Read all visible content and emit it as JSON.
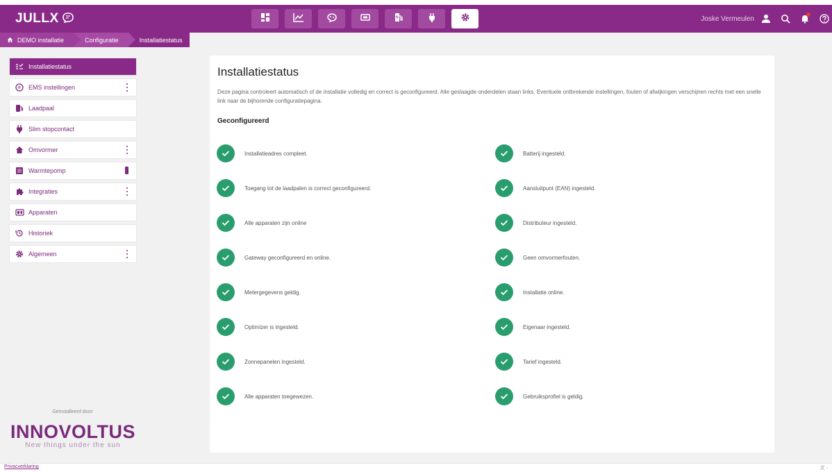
{
  "header": {
    "logo_text": "JULLX",
    "user_name": "Joske Vermeulen",
    "nav": [
      {
        "icon": "dashboard-icon",
        "active": false
      },
      {
        "icon": "chart-line-icon",
        "active": false
      },
      {
        "icon": "brain-icon",
        "active": false
      },
      {
        "icon": "battery-screen-icon",
        "active": false
      },
      {
        "icon": "charging-station-icon",
        "active": false
      },
      {
        "icon": "plug-icon",
        "active": false
      },
      {
        "icon": "gear-icon",
        "active": true
      }
    ]
  },
  "breadcrumbs": {
    "items": [
      "DEMO installatie",
      "Configuratie",
      "Installatiestatus"
    ]
  },
  "sidebar": {
    "items": [
      {
        "label": "Installatiestatus",
        "icon": "checklist-icon",
        "active": true,
        "menu": false
      },
      {
        "label": "EMS instellingen",
        "icon": "brain-icon",
        "active": false,
        "menu": true
      },
      {
        "label": "Laadpaal",
        "icon": "charging-station-icon",
        "active": false,
        "menu": false
      },
      {
        "label": "Slim stopcontact",
        "icon": "plug-icon",
        "active": false,
        "menu": false
      },
      {
        "label": "Omvormer",
        "icon": "house-icon",
        "active": false,
        "menu": true
      },
      {
        "label": "Warmtepomp",
        "icon": "heat-pump-icon",
        "active": false,
        "menu": false
      },
      {
        "label": "Integraties",
        "icon": "puzzle-icon",
        "active": false,
        "menu": true
      },
      {
        "label": "Apparaten",
        "icon": "devices-icon",
        "active": false,
        "menu": false
      },
      {
        "label": "Historiek",
        "icon": "history-icon",
        "active": false,
        "menu": false
      },
      {
        "label": "Algemeen",
        "icon": "gear-icon",
        "active": false,
        "menu": true
      }
    ],
    "installed_by_label": "Geïnstalleerd door:",
    "brand_name": "INNOVOLTUS",
    "brand_tagline": "New things under the sun"
  },
  "main": {
    "title": "Installatiestatus",
    "description": "Deze pagina controleert automatisch of de installatie volledig en correct is geconfigureerd. Alle geslaagde onderdelen staan links. Eventuele ontbrekende instellingen, fouten of afwijkingen verschijnen rechts met een snelle link naar de bijhorende configuratiepagina.",
    "section_title": "Geconfigureerd",
    "left_checks": [
      "Installatieadres compleet.",
      "Toegang tot de laadpalen is correct geconfigureerd.",
      "Alle apparaten zijn online",
      "Gateway geconfigureerd en online.",
      "Metergegevens geldig.",
      "Optimizer is ingesteld.",
      "Zonnepanelen ingesteld.",
      "Alle apparaten toegewezen."
    ],
    "right_checks": [
      "Batterij ingesteld.",
      "Aansluitpunt (EAN) ingesteld.",
      "Distributeur ingesteld.",
      "Geen omvormerfouten.",
      "Installatie online.",
      "Eigenaar ingesteld.",
      "Tarief ingesteld.",
      "Gebruiksprofiel is geldig."
    ]
  },
  "footer": {
    "privacy_label": "Privacverklaring",
    "lang_label": "文 -"
  },
  "colors": {
    "brand": "#8a2a88",
    "success": "#2a9d6e"
  }
}
